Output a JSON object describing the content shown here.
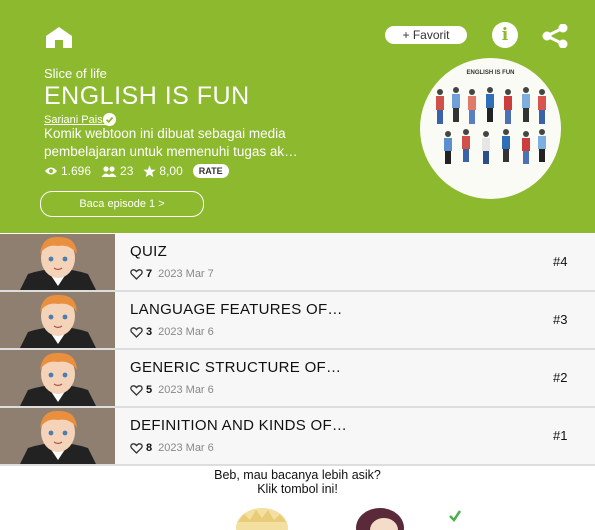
{
  "header": {
    "favorite_label": "+ Favorit",
    "info_label": "i",
    "icons": [
      "home-icon",
      "info-icon",
      "share-icon"
    ]
  },
  "series": {
    "genre": "Slice of life",
    "title": "ENGLISH IS FUN",
    "author": "Sariani Paisali",
    "description_line1": "Komik webtoon ini dibuat sebagai media",
    "description_line2": "pembelajaran untuk memenuhi tugas ak…",
    "views": "1.696",
    "subscribers": "23",
    "rating": "8,00",
    "rate_label": "RATE",
    "read_button": "Baca episode 1  >",
    "cover_title": "ENGLISH IS FUN"
  },
  "episodes": [
    {
      "title": "QUIZ",
      "likes": "7",
      "date": "2023 Mar 7",
      "number": "#4"
    },
    {
      "title": "LANGUAGE FEATURES OF…",
      "likes": "3",
      "date": "2023 Mar 6",
      "number": "#3"
    },
    {
      "title": "GENERIC STRUCTURE OF…",
      "likes": "5",
      "date": "2023 Mar 6",
      "number": "#2"
    },
    {
      "title": "DEFINITION AND KINDS OF…",
      "likes": "8",
      "date": "2023 Mar 6",
      "number": "#1"
    }
  ],
  "promo": {
    "line1": "Beb, mau bacanya lebih asik?",
    "line2": "Klik tombol ini!"
  },
  "colors": {
    "brand": "#8db92e",
    "background": "#ffffff",
    "row": "#f7f7f7"
  }
}
